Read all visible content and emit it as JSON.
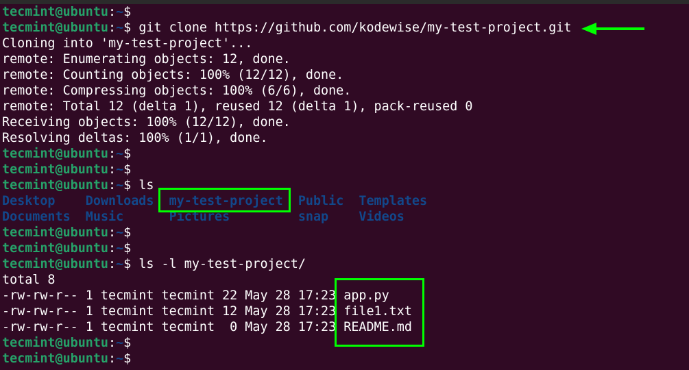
{
  "prompt": {
    "user": "tecmint@ubuntu",
    "colon": ":",
    "path": "~",
    "dollar": "$"
  },
  "lines": [
    {
      "type": "prompt",
      "cmd": ""
    },
    {
      "type": "prompt",
      "cmd": " git clone https://github.com/kodewise/my-test-project.git"
    },
    {
      "type": "out",
      "text": "Cloning into 'my-test-project'..."
    },
    {
      "type": "out",
      "text": "remote: Enumerating objects: 12, done."
    },
    {
      "type": "out",
      "text": "remote: Counting objects: 100% (12/12), done."
    },
    {
      "type": "out",
      "text": "remote: Compressing objects: 100% (6/6), done."
    },
    {
      "type": "out",
      "text": "remote: Total 12 (delta 1), reused 12 (delta 1), pack-reused 0"
    },
    {
      "type": "out",
      "text": "Receiving objects: 100% (12/12), done."
    },
    {
      "type": "out",
      "text": "Resolving deltas: 100% (1/1), done."
    },
    {
      "type": "prompt",
      "cmd": ""
    },
    {
      "type": "prompt",
      "cmd": ""
    },
    {
      "type": "prompt",
      "cmd": " ls"
    },
    {
      "type": "dirs",
      "items": [
        "Desktop    ",
        "Downloads  ",
        "my-test-project  ",
        "Public  ",
        "Templates"
      ]
    },
    {
      "type": "dirs",
      "items": [
        "Documents  ",
        "Music      ",
        "Pictures         ",
        "snap    ",
        "Videos"
      ]
    },
    {
      "type": "prompt",
      "cmd": ""
    },
    {
      "type": "prompt",
      "cmd": ""
    },
    {
      "type": "prompt",
      "cmd": " ls -l my-test-project/"
    },
    {
      "type": "out",
      "text": "total 8"
    },
    {
      "type": "out",
      "text": "-rw-rw-r-- 1 tecmint tecmint 22 May 28 17:23 app.py"
    },
    {
      "type": "out",
      "text": "-rw-rw-r-- 1 tecmint tecmint 12 May 28 17:23 file1.txt"
    },
    {
      "type": "out",
      "text": "-rw-rw-r-- 1 tecmint tecmint  0 May 28 17:23 README.md"
    },
    {
      "type": "prompt",
      "cmd": ""
    },
    {
      "type": "prompt",
      "cmd": ""
    }
  ],
  "colors": {
    "background": "#300a24",
    "prompt_user": "#26a269",
    "directory": "#12488b",
    "highlight": "#00ff00"
  }
}
